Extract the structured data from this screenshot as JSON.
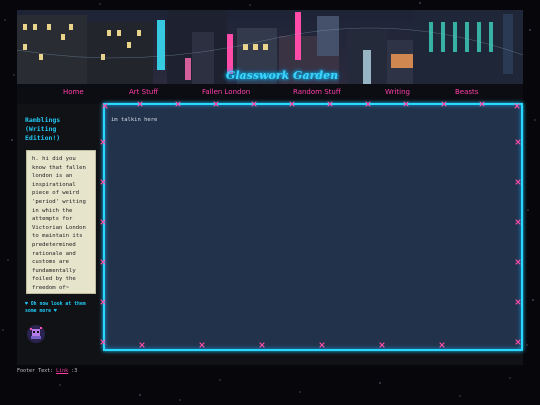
{
  "site": {
    "title": "Glasswork Garden"
  },
  "nav": {
    "items": [
      {
        "label": "Home"
      },
      {
        "label": "Art Stuff"
      },
      {
        "label": "Fallen London"
      },
      {
        "label": "Random Stuff"
      },
      {
        "label": "Writing"
      },
      {
        "label": "Beasts"
      }
    ]
  },
  "sidebar": {
    "heading": "Ramblings (Writing Edition!)",
    "note": "h. hi did you know that fallen london is an inspirational piece of weird 'period' writing in which the attempts for Victorian London to maintain its predetermined rationale and customs are fundamentally foiled by the freedom of~ (thrown into the pit)",
    "link": "♥ Oh now look at them some more ♥"
  },
  "main": {
    "text": "im talkin here"
  },
  "footer": {
    "prefix": "Footer Text: ",
    "link": "Link",
    "suffix": " :3"
  },
  "colors": {
    "accent_cyan": "#27d8ff",
    "accent_pink": "#ff3fa8",
    "panel": "#22324a",
    "note_bg": "#e7e4cc"
  },
  "icons": {
    "banner": "city-skyline",
    "avatar": "pixel-creature-icon",
    "frame": "pink-fairy-lights"
  }
}
